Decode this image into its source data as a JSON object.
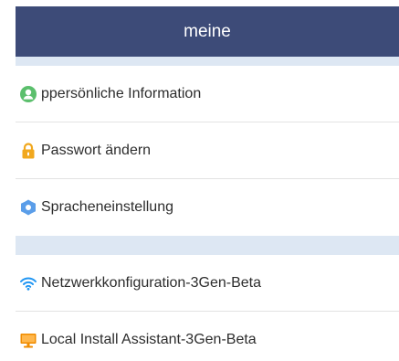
{
  "header": {
    "title": "meine"
  },
  "menu": {
    "group1": [
      {
        "label": "ppersönliche Information",
        "icon": "user-icon"
      },
      {
        "label": "Passwort ändern",
        "icon": "lock-icon"
      },
      {
        "label": "Spracheneinstellung",
        "icon": "gear-icon"
      }
    ],
    "group2": [
      {
        "label": "Netzwerkkonfiguration-3Gen-Beta",
        "icon": "wifi-icon"
      },
      {
        "label": "Local Install Assistant-3Gen-Beta",
        "icon": "monitor-icon"
      }
    ]
  },
  "colors": {
    "header_bg": "#3d4b78",
    "separator_band": "#dde7f3",
    "user_icon": "#5bbf6c",
    "lock_icon": "#f1a81e",
    "gear_icon": "#5b9ee9",
    "wifi_icon": "#2196f3",
    "monitor_icon": "#f08c00"
  }
}
